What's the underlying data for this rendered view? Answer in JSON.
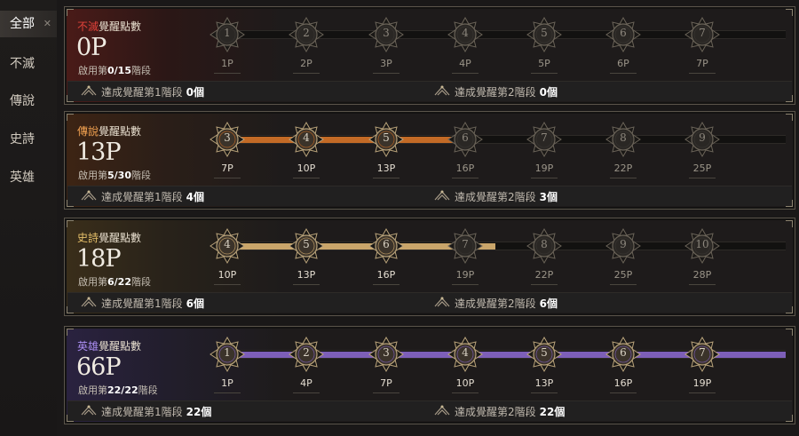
{
  "sidebar": {
    "items": [
      {
        "label": "全部",
        "active": true
      },
      {
        "label": "不滅",
        "active": false
      },
      {
        "label": "傳說",
        "active": false
      },
      {
        "label": "史詩",
        "active": false
      },
      {
        "label": "英雄",
        "active": false
      }
    ],
    "close_glyph": "✕"
  },
  "common": {
    "stage_prefix": "啟用第",
    "stage_suffix": "階段",
    "achv1_label": "達成覺醒第1階段",
    "achv2_label": "達成覺醒第2階段",
    "title_suffix": "覺醒點數"
  },
  "cards": [
    {
      "grade": "不滅",
      "grade_color": "#e0423a",
      "points": "0P",
      "stage": "0/15",
      "achv1_count": "0個",
      "achv2_count": "0個",
      "fill_color": "#3a3633",
      "fill_fraction": 0,
      "bg": "linear-gradient(90deg,#4a1b18 0%,#2b1716 14%,#1e1b1b 30%)",
      "nodes": [
        {
          "num": "1",
          "label": "1P",
          "active": false
        },
        {
          "num": "2",
          "label": "2P",
          "active": false
        },
        {
          "num": "3",
          "label": "3P",
          "active": false
        },
        {
          "num": "4",
          "label": "4P",
          "active": false
        },
        {
          "num": "5",
          "label": "5P",
          "active": false
        },
        {
          "num": "6",
          "label": "6P",
          "active": false
        },
        {
          "num": "7",
          "label": "7P",
          "active": false
        }
      ]
    },
    {
      "grade": "傳說",
      "grade_color": "#f0a050",
      "points": "13P",
      "stage": "5/30",
      "achv1_count": "4個",
      "achv2_count": "3個",
      "fill_color": "#c36a26",
      "fill_fraction": 0.41,
      "bg": "linear-gradient(90deg,#3d2414 0%,#2a1e18 14%,#1e1b1b 30%)",
      "nodes": [
        {
          "num": "3",
          "label": "7P",
          "active": true
        },
        {
          "num": "4",
          "label": "10P",
          "active": true
        },
        {
          "num": "5",
          "label": "13P",
          "active": true
        },
        {
          "num": "6",
          "label": "16P",
          "active": false
        },
        {
          "num": "7",
          "label": "19P",
          "active": false
        },
        {
          "num": "8",
          "label": "22P",
          "active": false
        },
        {
          "num": "9",
          "label": "25P",
          "active": false
        }
      ]
    },
    {
      "grade": "史詩",
      "grade_color": "#e6c06a",
      "points": "18P",
      "stage": "6/22",
      "achv1_count": "6個",
      "achv2_count": "6個",
      "fill_color": "#c9a56a",
      "fill_fraction": 0.485,
      "bg": "linear-gradient(90deg,#3a2e1a 0%,#28221a 14%,#1e1b1b 30%)",
      "nodes": [
        {
          "num": "4",
          "label": "10P",
          "active": true
        },
        {
          "num": "5",
          "label": "13P",
          "active": true
        },
        {
          "num": "6",
          "label": "16P",
          "active": true
        },
        {
          "num": "7",
          "label": "19P",
          "active": false
        },
        {
          "num": "8",
          "label": "22P",
          "active": false
        },
        {
          "num": "9",
          "label": "25P",
          "active": false
        },
        {
          "num": "10",
          "label": "28P",
          "active": false
        }
      ]
    },
    {
      "grade": "英雄",
      "grade_color": "#a98cf0",
      "points": "66P",
      "stage": "22/22",
      "achv1_count": "22個",
      "achv2_count": "22個",
      "fill_color": "#7d5fb8",
      "fill_fraction": 1.0,
      "bg": "linear-gradient(90deg,#2a2240 0%,#221e2c 14%,#1e1b1b 30%)",
      "nodes": [
        {
          "num": "1",
          "label": "1P",
          "active": true
        },
        {
          "num": "2",
          "label": "4P",
          "active": true
        },
        {
          "num": "3",
          "label": "7P",
          "active": true
        },
        {
          "num": "4",
          "label": "10P",
          "active": true
        },
        {
          "num": "5",
          "label": "13P",
          "active": true
        },
        {
          "num": "6",
          "label": "16P",
          "active": true
        },
        {
          "num": "7",
          "label": "19P",
          "active": true
        }
      ]
    }
  ]
}
